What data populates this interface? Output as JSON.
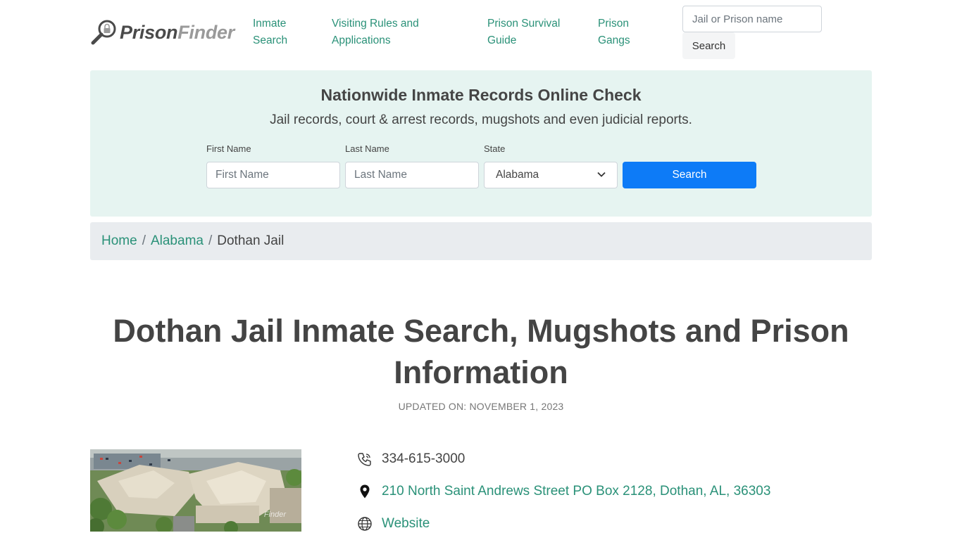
{
  "header": {
    "logo": {
      "part1": "Prison",
      "part2": "Finder"
    },
    "nav": [
      {
        "label_line1": "Inmate",
        "label_line2": "Search"
      },
      {
        "label_line1": "Visiting Rules and",
        "label_line2": "Applications"
      },
      {
        "label_line1": "Prison Survival",
        "label_line2": "Guide"
      },
      {
        "label_line1": "Prison",
        "label_line2": "Gangs"
      }
    ],
    "search": {
      "placeholder": "Jail or Prison name",
      "button_label": "Search"
    }
  },
  "records_check": {
    "title": "Nationwide Inmate Records Online Check",
    "subtitle": "Jail records, court & arrest records, mugshots and even judicial reports.",
    "first_name": {
      "label": "First Name",
      "placeholder": "First Name"
    },
    "last_name": {
      "label": "Last Name",
      "placeholder": "Last Name"
    },
    "state": {
      "label": "State",
      "selected": "Alabama"
    },
    "button_label": "Search"
  },
  "breadcrumb": {
    "home": "Home",
    "separator": "/",
    "state": "Alabama",
    "current": "Dothan Jail"
  },
  "page": {
    "title_line1": "Dothan Jail Inmate Search, Mugshots and Prison",
    "title_line2": "Information",
    "updated": "UPDATED ON: NOVEMBER 1, 2023"
  },
  "contact": {
    "phone": "334-615-3000",
    "address": "210 North Saint Andrews Street PO Box 2128, Dothan, AL, 36303",
    "website_label": "Website"
  },
  "photo": {
    "watermark": "Finder"
  },
  "colors": {
    "accent": "#2a9178",
    "primary_button": "#0d7bf7",
    "records_bg": "#e6f4f1",
    "breadcrumb_bg": "#e9ecef"
  }
}
